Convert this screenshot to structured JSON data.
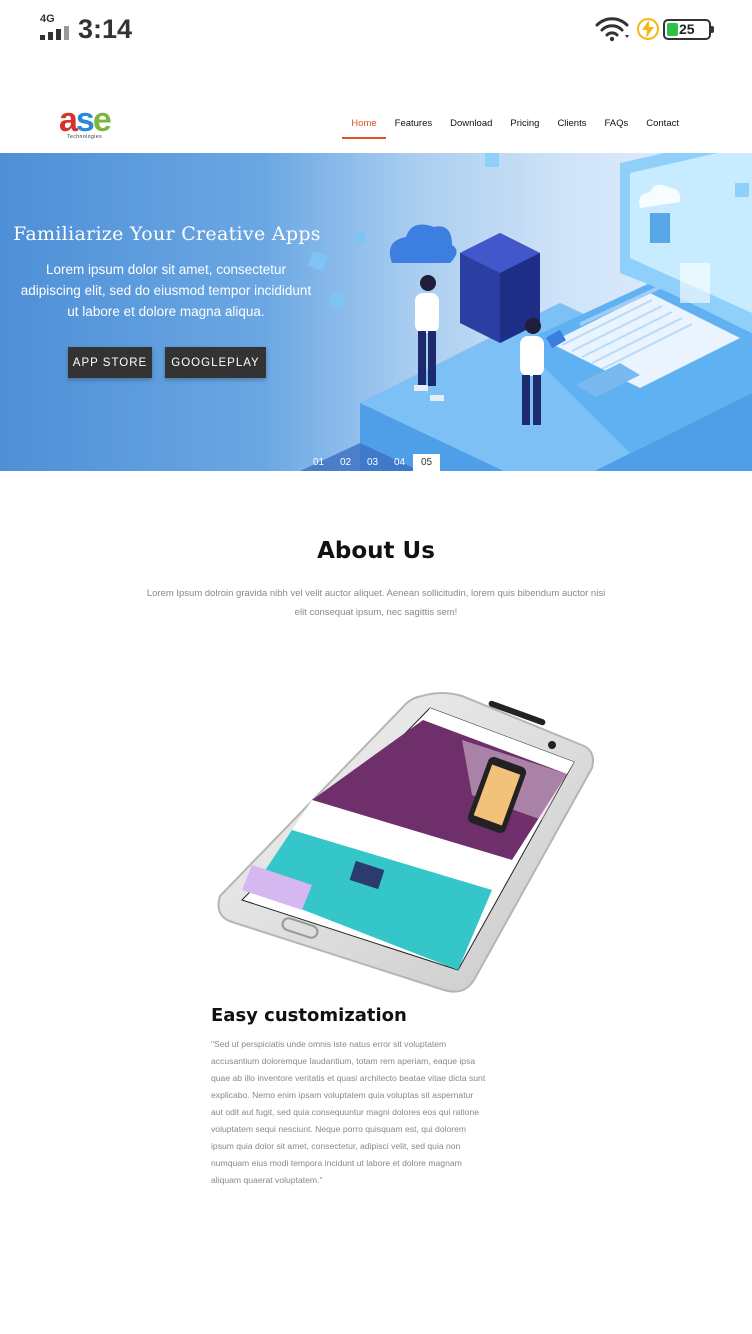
{
  "status_bar": {
    "network": "4G",
    "time": "3:14",
    "battery_level": "25",
    "icons": [
      "signal-icon",
      "wifi-icon",
      "charging-bolt-icon",
      "battery-icon"
    ]
  },
  "header": {
    "logo": {
      "letters": "ase",
      "subtitle": "Technologies"
    },
    "nav": [
      "Home",
      "Features",
      "Download",
      "Pricing",
      "Clients",
      "FAQs",
      "Contact"
    ],
    "active_nav": "Home"
  },
  "hero": {
    "title": "Familiarize Your Creative Apps",
    "text": "Lorem ipsum dolor sit amet, consectetur adipiscing elit, sed do eiusmod tempor incididunt ut labore et dolore magna aliqua.",
    "buttons": {
      "appstore": "APP STORE",
      "googleplay": "GOOGLEPLAY"
    },
    "slides": [
      "01",
      "02",
      "03",
      "04",
      "05"
    ],
    "active_slide": "05"
  },
  "about": {
    "title": "About Us",
    "text": "Lorem Ipsum dolroin gravida nibh vel velit auctor aliquet. Aenean sollicitudin, lorem quis bibendum auctor nisi elit consequat ipsum, nec sagittis sem!"
  },
  "feature": {
    "title": "Easy customization",
    "text": "\"Sed ut perspiciatis unde omnis iste natus error sit voluptatem accusantium doloremque laudantium, totam rem aperiam, eaque ipsa quae ab illo inventore veritatis et quasi architecto beatae vitae dicta sunt explicabo. Nemo enim ipsam voluptatem quia voluptas sit aspernatur aut odit aut fugit, sed quia consequuntur magni dolores eos qui ratione voluptatem sequi nesciunt. Neque porro quisquam est, qui dolorem ipsum quia dolor sit amet, consectetur, adipisci velit, sed quia non numquam eius modi tempora incidunt ut labore et dolore magnam aliquam quaerat voluptatem.\""
  },
  "colors": {
    "accent": "#e0541e",
    "button_bg": "#333333",
    "hero_blue": "#4e8fd6",
    "battery_green": "#2fc04b"
  }
}
